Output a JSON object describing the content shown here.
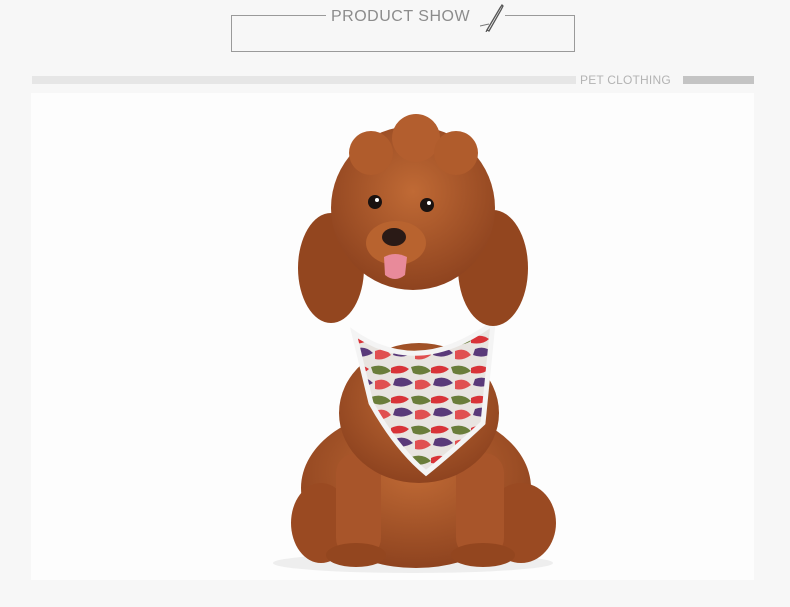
{
  "header": {
    "title": "PRODUCT SHOW",
    "icon": "pen-icon"
  },
  "section": {
    "label": "PET CLOTHING"
  },
  "photo": {
    "subject": "poodle-in-camo-harness"
  },
  "colors": {
    "line": "#9a9a9a",
    "text": "#8c8c8c",
    "band_light": "#e6e6e6",
    "band_dark": "#c4c4c4",
    "fur": "#a8552a"
  }
}
